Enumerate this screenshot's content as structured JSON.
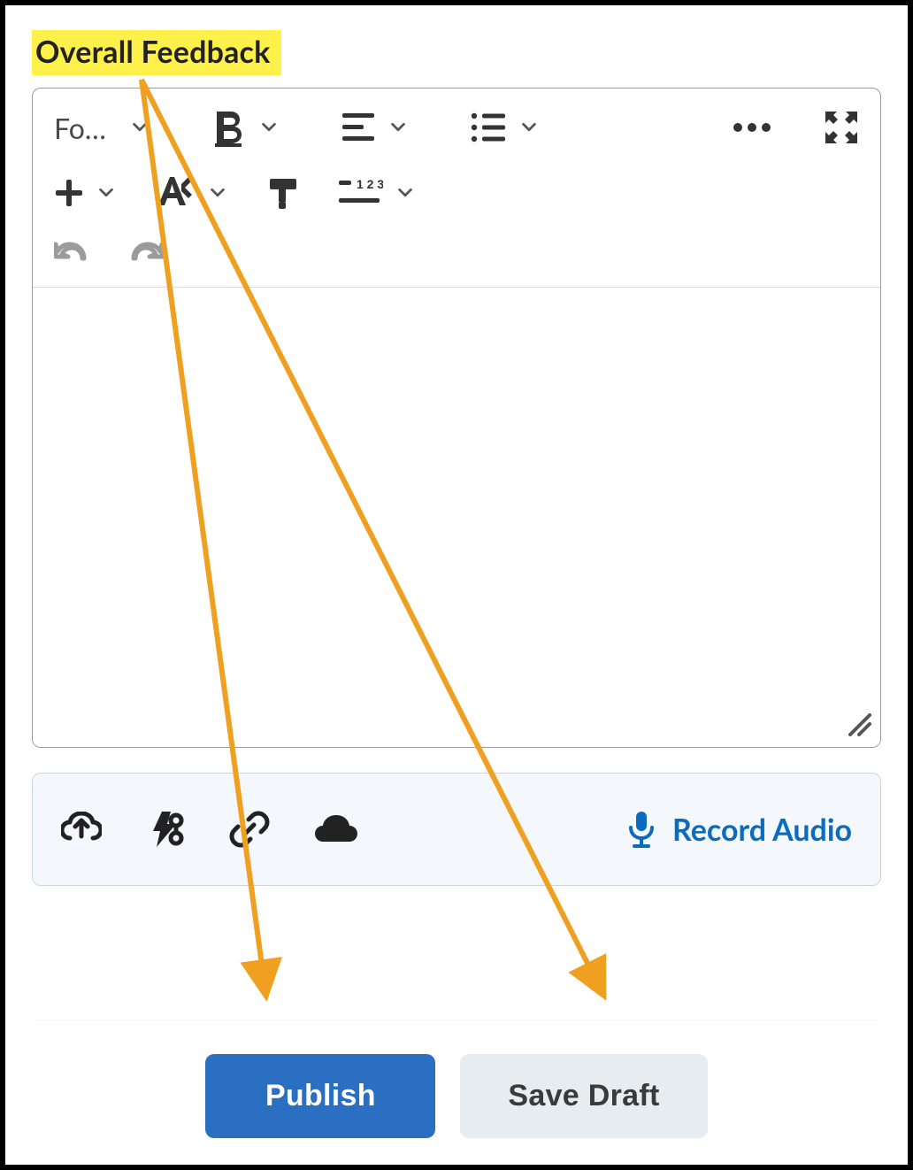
{
  "header": {
    "title": "Overall Feedback"
  },
  "toolbar": {
    "font_label": "Fo…",
    "icons": {
      "bold": "bold-icon",
      "align": "align-icon",
      "list": "list-icon",
      "more": "more-icon",
      "fullscreen": "fullscreen-icon",
      "plus": "plus-icon",
      "textstyle": "text-style-icon",
      "format": "format-painter-icon",
      "numbered": "numbered-list-icon",
      "undo": "undo-icon",
      "redo": "redo-icon"
    }
  },
  "attachments": {
    "icons": {
      "upload": "cloud-upload-icon",
      "quicklink": "quicklink-icon",
      "link": "link-icon",
      "drive": "cloud-drive-icon",
      "mic": "microphone-icon"
    },
    "record_label": "Record Audio"
  },
  "footer": {
    "publish_label": "Publish",
    "save_draft_label": "Save Draft"
  },
  "colors": {
    "highlight": "#fff04a",
    "primary": "#2a6fc2",
    "link": "#0b6cbf",
    "annotation": "#f0a020"
  }
}
